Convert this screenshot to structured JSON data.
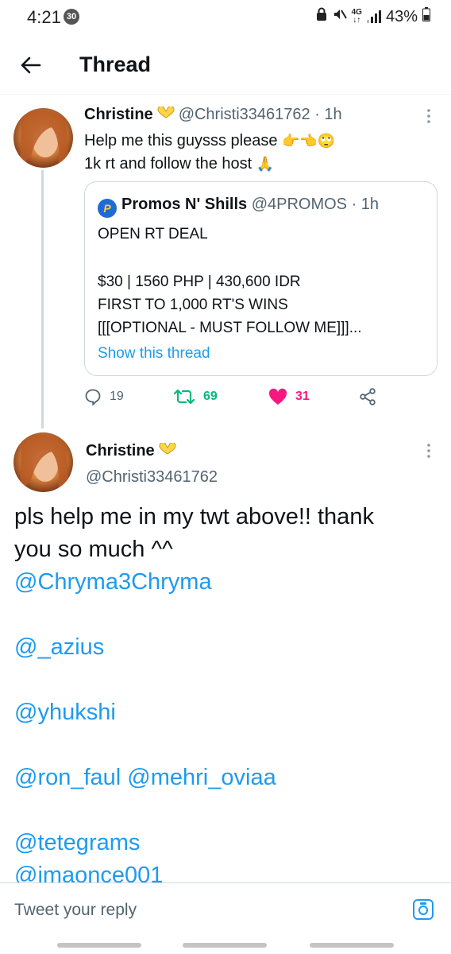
{
  "status_bar": {
    "time": "4:21",
    "notif_count": "30",
    "network": "4G",
    "battery": "43%"
  },
  "header": {
    "title": "Thread"
  },
  "tweet1": {
    "name": "Christine",
    "handle": "@Christi33461762",
    "time": "· 1h",
    "line1": "Help me this guysss please",
    "line1_emoji": "👉👈🙄",
    "line2": "1k rt and follow the host",
    "line2_emoji": "🙏",
    "quote": {
      "name": "Promos N' Shills",
      "handle": "@4PROMOS",
      "time": "· 1h",
      "line1": "OPEN RT DEAL",
      "line2": "$30 | 1560 PHP | 430,600 IDR",
      "line3": "FIRST TO 1,000 RT'S WINS",
      "line4": "[[[OPTIONAL - MUST FOLLOW ME]]]...",
      "show_thread": "Show this thread"
    },
    "replies": "19",
    "retweets": "69",
    "likes": "31",
    "colors": {
      "retweet": "#00ba7c",
      "like": "#f91880",
      "link": "#1d9bf0"
    }
  },
  "tweet2": {
    "name": "Christine",
    "handle": "@Christi33461762",
    "text_line1": "pls help me in my twt above!! thank",
    "text_line2": "you so much ^^",
    "mentions": [
      "@Chryma3Chryma",
      "",
      "@_azius",
      "",
      "@yhukshi",
      "",
      "@ron_faul @mehri_oviaa",
      "",
      "@tetegrams",
      "@imaonce001"
    ]
  },
  "reply_bar": {
    "placeholder": "Tweet your reply"
  }
}
